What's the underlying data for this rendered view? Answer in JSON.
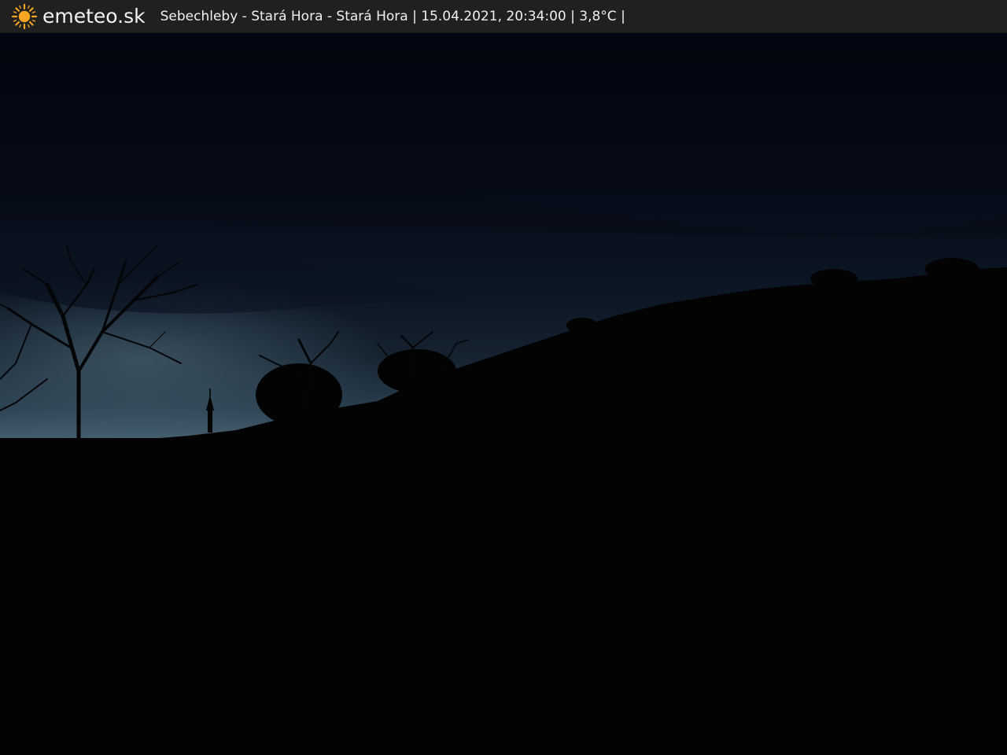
{
  "header": {
    "brand": "emeteo.sk",
    "logo_icon": "sun-icon",
    "caption": "Sebechleby - Stará Hora - Stará Hora | 15.04.2021, 20:34:00 | 3,8°C |"
  },
  "colors": {
    "header_bg": "#202020",
    "sun": "#f5a623",
    "sky_top": "#03050f",
    "sky_mid": "#0e1928",
    "sky_horizon": "#3a5466",
    "ground": "#030304"
  }
}
